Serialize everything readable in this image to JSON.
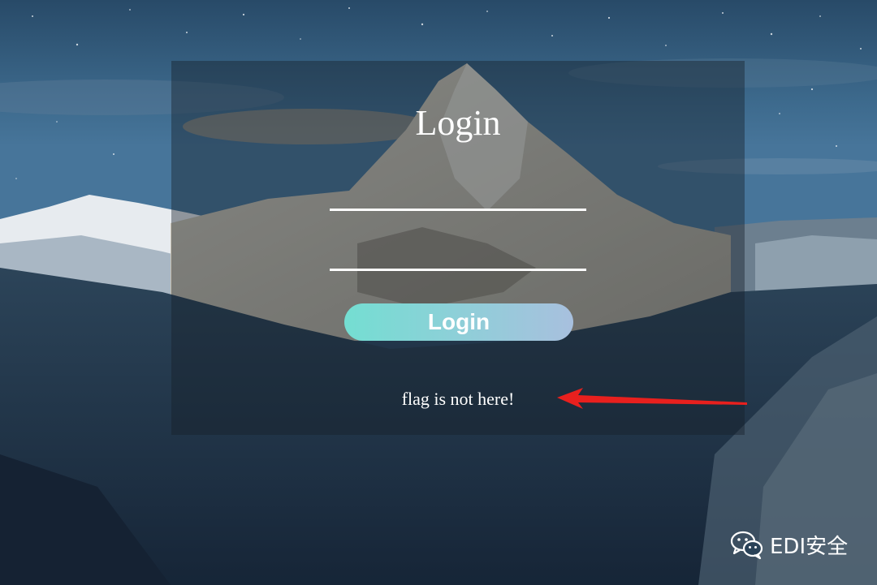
{
  "login": {
    "title": "Login",
    "username_value": "",
    "password_value": "",
    "button_label": "Login",
    "message": "flag is not here!"
  },
  "watermark": {
    "text": "EDI安全",
    "icon": "wechat-icon"
  },
  "colors": {
    "button_gradient_start": "#74ded2",
    "button_gradient_end": "#a8c0de",
    "annotation_arrow": "#e8201e",
    "panel_overlay": "rgba(22,30,40,0.42)"
  }
}
